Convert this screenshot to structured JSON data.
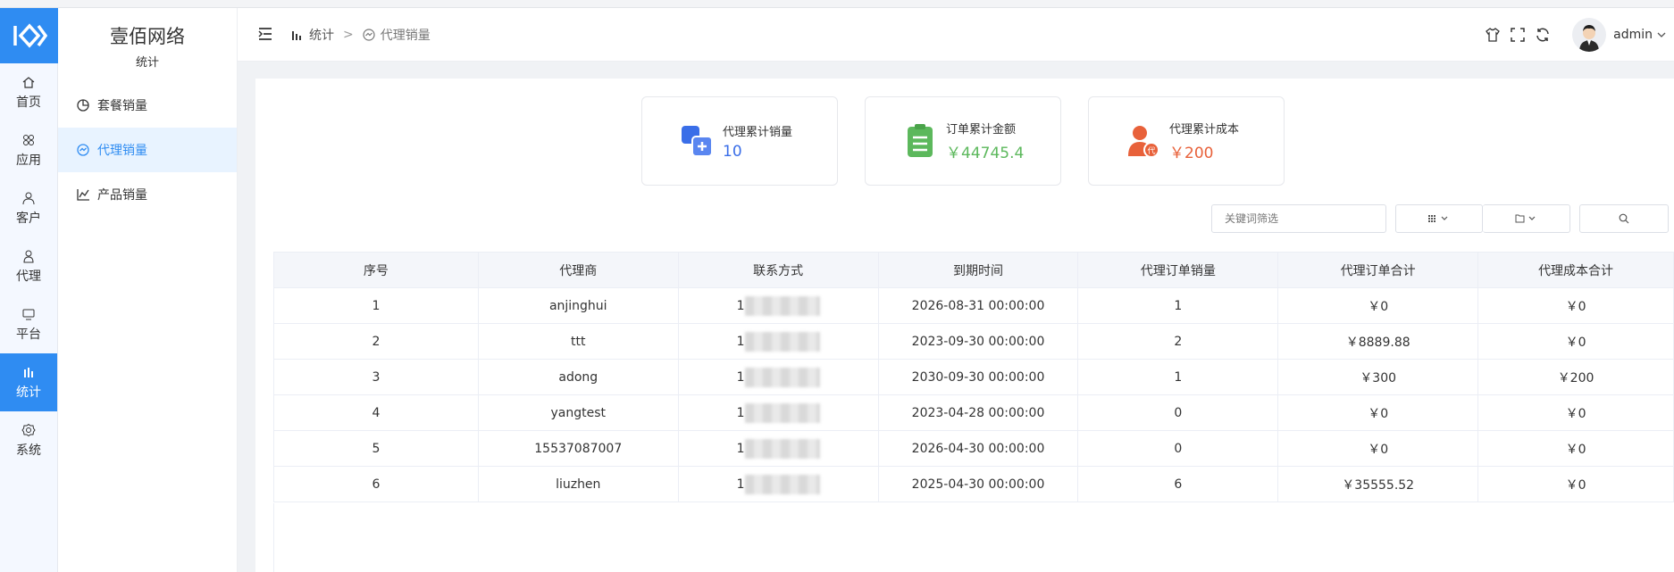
{
  "brand": {
    "name": "壹佰网络",
    "section": "统计"
  },
  "rail": [
    {
      "label": "首页",
      "icon": "home-icon"
    },
    {
      "label": "应用",
      "icon": "apps-icon"
    },
    {
      "label": "客户",
      "icon": "user-icon"
    },
    {
      "label": "代理",
      "icon": "agent-icon"
    },
    {
      "label": "平台",
      "icon": "platform-icon"
    },
    {
      "label": "统计",
      "icon": "stats-icon",
      "active": true
    },
    {
      "label": "系统",
      "icon": "gear-icon"
    }
  ],
  "subnav": [
    {
      "label": "套餐销量",
      "icon": "pie-chart-icon"
    },
    {
      "label": "代理销量",
      "icon": "agent-chart-icon",
      "active": true
    },
    {
      "label": "产品销量",
      "icon": "line-chart-icon"
    }
  ],
  "breadcrumb": {
    "root": "统计",
    "separator": ">",
    "current": "代理销量"
  },
  "user": {
    "name": "admin"
  },
  "stats": [
    {
      "label": "代理累计销量",
      "value": "10",
      "color": "#3a6ee8"
    },
    {
      "label": "订单累计金额",
      "value": "￥44745.4",
      "color": "#5cb85c"
    },
    {
      "label": "代理累计成本",
      "value": "￥200",
      "color": "#e8613a"
    }
  ],
  "filter": {
    "placeholder": "关键词筛选"
  },
  "table": {
    "headers": [
      "序号",
      "代理商",
      "联系方式",
      "到期时间",
      "代理订单销量",
      "代理订单合计",
      "代理成本合计"
    ],
    "rows": [
      [
        "1",
        "anjinghui",
        "1",
        "2026-08-31 00:00:00",
        "1",
        "￥0",
        "￥0"
      ],
      [
        "2",
        "ttt",
        "1",
        "2023-09-30 00:00:00",
        "2",
        "￥8889.88",
        "￥0"
      ],
      [
        "3",
        "adong",
        "1",
        "2030-09-30 00:00:00",
        "1",
        "￥300",
        "￥200"
      ],
      [
        "4",
        "yangtest",
        "1",
        "2023-04-28 00:00:00",
        "0",
        "￥0",
        "￥0"
      ],
      [
        "5",
        "15537087007",
        "1",
        "2026-04-30 00:00:00",
        "0",
        "￥0",
        "￥0"
      ],
      [
        "6",
        "liuzhen",
        "1",
        "2025-04-30 00:00:00",
        "6",
        "￥35555.52",
        "￥0"
      ]
    ]
  }
}
